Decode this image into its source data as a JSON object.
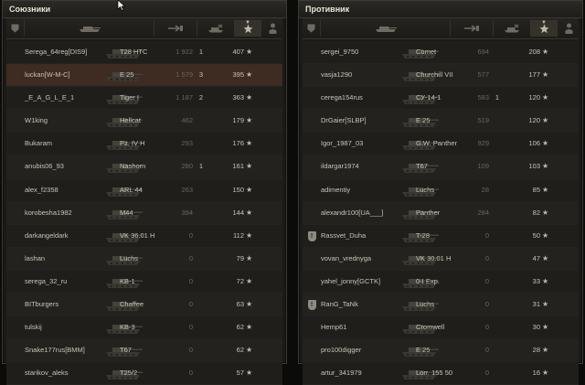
{
  "allies": {
    "title": "Союзники",
    "columns": [
      {
        "icon": "badge-icon"
      },
      {
        "icon": "tank-icon"
      },
      {
        "icon": "damage-icon"
      },
      {
        "icon": "destroyed-tank-icon"
      },
      {
        "icon": "star-icon",
        "sorted": true
      },
      {
        "icon": "player-icon"
      }
    ],
    "rows": [
      {
        "name": "Serega_64reg[DIS9]",
        "tank": "T28 HTC",
        "damage": "1 922",
        "kills": "1",
        "xp": "407",
        "star": "★",
        "badge": "",
        "highlight": false
      },
      {
        "name": "luckan[W-M-C]",
        "tank": "E 25",
        "damage": "1 579",
        "kills": "3",
        "xp": "395",
        "star": "★",
        "badge": "",
        "highlight": true
      },
      {
        "name": "_E_A_G_L_E_1",
        "tank": "Tiger I",
        "damage": "1 187",
        "kills": "2",
        "xp": "363",
        "star": "★",
        "badge": "",
        "highlight": false
      },
      {
        "name": "W1king",
        "tank": "Hellcat",
        "damage": "462",
        "kills": "",
        "xp": "179",
        "star": "★",
        "badge": "",
        "highlight": false
      },
      {
        "name": "Bukaram",
        "tank": "Pz. IV H",
        "damage": "293",
        "kills": "",
        "xp": "176",
        "star": "★",
        "badge": "",
        "highlight": false
      },
      {
        "name": "anubis06_93",
        "tank": "Nashorn",
        "damage": "280",
        "kills": "1",
        "xp": "161",
        "star": "★",
        "badge": "",
        "highlight": false
      },
      {
        "name": "alex_f2358",
        "tank": "ARL 44",
        "damage": "263",
        "kills": "",
        "xp": "150",
        "star": "★",
        "badge": "",
        "highlight": false
      },
      {
        "name": "korobesha1982",
        "tank": "M44",
        "damage": "394",
        "kills": "",
        "xp": "144",
        "star": "★",
        "badge": "",
        "highlight": false
      },
      {
        "name": "darkangeldark",
        "tank": "VK 36.01 H",
        "damage": "0",
        "kills": "",
        "xp": "112",
        "star": "★",
        "badge": "",
        "highlight": false
      },
      {
        "name": "lashan",
        "tank": "Luchs",
        "damage": "0",
        "kills": "",
        "xp": "79",
        "star": "★",
        "badge": "",
        "highlight": false
      },
      {
        "name": "serega_32_ru",
        "tank": "KB-1",
        "damage": "0",
        "kills": "",
        "xp": "72",
        "star": "★",
        "badge": "",
        "highlight": false
      },
      {
        "name": "BITburgers",
        "tank": "Chaffee",
        "damage": "0",
        "kills": "",
        "xp": "63",
        "star": "★",
        "badge": "",
        "highlight": false
      },
      {
        "name": "tulskij",
        "tank": "KB-3",
        "damage": "0",
        "kills": "",
        "xp": "62",
        "star": "★",
        "badge": "",
        "highlight": false
      },
      {
        "name": "Snake177rus[BMM]",
        "tank": "T67",
        "damage": "0",
        "kills": "",
        "xp": "62",
        "star": "★",
        "badge": "",
        "highlight": false
      },
      {
        "name": "starikov_aleks",
        "tank": "T25/2",
        "damage": "0",
        "kills": "",
        "xp": "57",
        "star": "★",
        "badge": "",
        "highlight": false
      }
    ]
  },
  "enemies": {
    "title": "Противник",
    "columns": [
      {
        "icon": "badge-icon"
      },
      {
        "icon": "tank-icon"
      },
      {
        "icon": "damage-icon"
      },
      {
        "icon": "destroyed-tank-icon"
      },
      {
        "icon": "star-icon",
        "sorted": true
      },
      {
        "icon": "player-icon"
      }
    ],
    "rows": [
      {
        "name": "sergei_9750",
        "tank": "Comet",
        "damage": "694",
        "kills": "",
        "xp": "208",
        "star": "★",
        "badge": "",
        "highlight": false
      },
      {
        "name": "vasja1290",
        "tank": "Churchill VII",
        "damage": "577",
        "kills": "",
        "xp": "177",
        "star": "★",
        "badge": "",
        "highlight": false
      },
      {
        "name": "cerega154rus",
        "tank": "СУ-14-1",
        "damage": "583",
        "kills": "1",
        "xp": "120",
        "star": "★",
        "badge": "",
        "highlight": false
      },
      {
        "name": "DrGaier[SLBP]",
        "tank": "E 25",
        "damage": "519",
        "kills": "",
        "xp": "120",
        "star": "★",
        "badge": "",
        "highlight": false
      },
      {
        "name": "Igor_1987_03",
        "tank": "G.W. Panther",
        "damage": "929",
        "kills": "",
        "xp": "106",
        "star": "★",
        "badge": "",
        "highlight": false
      },
      {
        "name": "ildargar1974",
        "tank": "T67",
        "damage": "109",
        "kills": "",
        "xp": "103",
        "star": "★",
        "badge": "",
        "highlight": false
      },
      {
        "name": "adimentiy",
        "tank": "Luchs",
        "damage": "28",
        "kills": "",
        "xp": "85",
        "star": "★",
        "badge": "",
        "highlight": false
      },
      {
        "name": "alexandr100[UA___]",
        "tank": "Panther",
        "damage": "284",
        "kills": "",
        "xp": "82",
        "star": "★",
        "badge": "",
        "highlight": false
      },
      {
        "name": "Rassvet_Duha",
        "tank": "T-28",
        "damage": "0",
        "kills": "",
        "xp": "50",
        "star": "★",
        "badge": "!",
        "highlight": false
      },
      {
        "name": "vovan_vrednyga",
        "tank": "VK 30.01 H",
        "damage": "0",
        "kills": "",
        "xp": "47",
        "star": "★",
        "badge": "",
        "highlight": false
      },
      {
        "name": "yahel_jonny[GCTK]",
        "tank": "0-I Exp.",
        "damage": "0",
        "kills": "",
        "xp": "33",
        "star": "★",
        "badge": "",
        "highlight": false
      },
      {
        "name": "RanG_TaNk",
        "tank": "Luchs",
        "damage": "0",
        "kills": "",
        "xp": "31",
        "star": "★",
        "badge": "!",
        "highlight": false
      },
      {
        "name": "Hemp61",
        "tank": "Cromwell",
        "damage": "0",
        "kills": "",
        "xp": "30",
        "star": "★",
        "badge": "",
        "highlight": false
      },
      {
        "name": "pro100digger",
        "tank": "E 25",
        "damage": "0",
        "kills": "",
        "xp": "28",
        "star": "★",
        "badge": "",
        "highlight": false
      },
      {
        "name": "artur_341979",
        "tank": "Lorr. 155 50",
        "damage": "0",
        "kills": "",
        "xp": "16",
        "star": "★",
        "badge": "",
        "highlight": false
      }
    ]
  }
}
